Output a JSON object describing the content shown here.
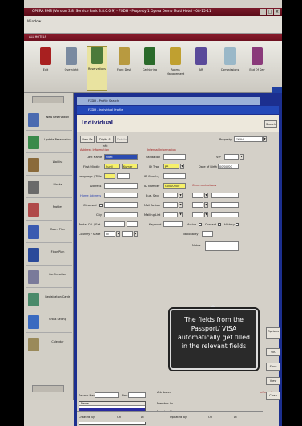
{
  "window": {
    "title": "OPERA PMS [Version 3.8, Service Pack 3.8.0.0.9] - FXDH - Property 1 Opera Demo Multi Hotel - 08-15-11",
    "menu": "Window",
    "subbar": "ALL HOTELS"
  },
  "toolbar": {
    "items": [
      "Exit",
      "Overnight",
      "Reservations",
      "Front Desk",
      "Cashiering",
      "Rooms Management",
      "AR",
      "Commissions",
      "End Of Day"
    ]
  },
  "sidebar": {
    "items": [
      "New Reservation",
      "Update Reservation",
      "Waitlist",
      "Blocks",
      "Profiles",
      "Room Plan",
      "Floor Plan",
      "Confirmation",
      "Registration Cards",
      "Cross Selling",
      "Calendar"
    ]
  },
  "windows": {
    "search": "FXDH - Profile Search",
    "profile": "FXDH - Individual Profile"
  },
  "profile": {
    "heading": "Individual",
    "search_button": "Search",
    "buttons": {
      "new_pa": "New Pa",
      "digits": "Digits & Info",
      "details": "Details"
    },
    "property_label": "Property",
    "property_value": "FXDH",
    "address_section": "Address Information",
    "internal_section": "Internal Information",
    "communications_section": "Communications",
    "labels": {
      "last_name": "Last Name",
      "first_middle": "First/Middle",
      "language_title": "Language / Title",
      "address": "Address",
      "home_address": "Home Address",
      "cleansed": "Cleansed",
      "city": "City",
      "postal_ext": "Postal Cd. / Ext.",
      "country_state": "Country / State",
      "salutation": "Salutation",
      "id_type": "ID Type",
      "id_country": "ID Country",
      "id_number": "ID Number",
      "bus_seg": "Bus. Seg.",
      "mail_action": "Mail Action",
      "mailing_list": "Mailing List",
      "keyword": "Keyword",
      "vip": "VIP",
      "date_of_birth": "Date of Birth",
      "nationality": "Nationality",
      "notes": "Notes",
      "active": "Active",
      "contact": "Contact",
      "history": "History"
    },
    "values": {
      "last_name": "Skelt",
      "first_name": "Sunil",
      "middle_name": "Kumar",
      "id_type": "PP",
      "id_number": "G0000000",
      "date_of_birth": "00/00/00",
      "country": "IN"
    }
  },
  "bottom": {
    "search_name_label": "Search Name",
    "first_label": "First",
    "list_header": "Name",
    "attributes_label": "Attributes",
    "membership_label": "Information",
    "member_label": "Member Lv.",
    "member_since": "Member Since",
    "membership": "Membership",
    "created_by": "Created By",
    "on": "On",
    "at": "At",
    "updated_by": "Updated By",
    "on2": "On",
    "at2": "At"
  },
  "side_buttons": [
    "Options",
    "OK",
    "Save",
    "View",
    "Close"
  ],
  "tooltip": "The fields from the Passport/ VISA automatically get filled in the relevant fields"
}
